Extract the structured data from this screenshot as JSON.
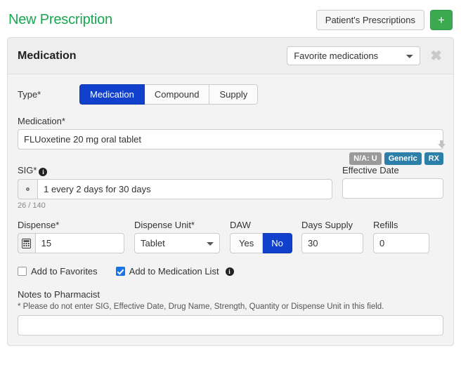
{
  "header": {
    "title": "New Prescription",
    "patient_prescriptions_label": "Patient's Prescriptions",
    "add_label": "+"
  },
  "panel": {
    "title": "Medication",
    "favorites_select": {
      "selected": "Favorite medications",
      "options": [
        "Favorite medications"
      ]
    },
    "close_label": "✖"
  },
  "type_field": {
    "label": "Type*",
    "options": [
      "Medication",
      "Compound",
      "Supply"
    ],
    "selected": "Medication"
  },
  "medication_field": {
    "label": "Medication*",
    "value": "FLUoxetine 20 mg oral tablet",
    "placeholder": "",
    "badges": [
      {
        "text": "N/A: U",
        "color": "#9a9a9a"
      },
      {
        "text": "Generic",
        "color": "#2b7fa8"
      },
      {
        "text": "RX",
        "color": "#2b7fa8"
      }
    ]
  },
  "sig_field": {
    "label": "SIG*",
    "value": "1 every 2 days for 30 days",
    "placeholder": "",
    "char_count": "26 / 140",
    "info_icon": "info-icon",
    "gear_icon": "gear-icon"
  },
  "effective_date_field": {
    "label": "Effective Date",
    "value": "",
    "placeholder": ""
  },
  "dispense_field": {
    "label": "Dispense*",
    "value": "15",
    "calculator_icon": "calculator-icon"
  },
  "dispense_unit_field": {
    "label": "Dispense Unit*",
    "selected": "Tablet",
    "options": [
      "Tablet"
    ]
  },
  "daw_field": {
    "label": "DAW",
    "options": [
      "Yes",
      "No"
    ],
    "selected": "No"
  },
  "days_supply_field": {
    "label": "Days Supply",
    "value": "30"
  },
  "refills_field": {
    "label": "Refills",
    "value": "0"
  },
  "checkboxes": {
    "add_to_favorites": {
      "label": "Add to Favorites",
      "checked": false
    },
    "add_to_medication_list": {
      "label": "Add to Medication List",
      "checked": true
    }
  },
  "notes_field": {
    "label": "Notes to Pharmacist",
    "hint": "* Please do not enter SIG, Effective Date, Drug Name, Strength, Quantity or Dispense Unit in this field.",
    "value": "",
    "placeholder": ""
  },
  "colors": {
    "brand_green": "#17a74f",
    "accent_blue": "#1040cc",
    "badge_teal": "#2b7fa8",
    "badge_gray": "#9a9a9a",
    "checkbox_blue": "#1a73e8"
  }
}
